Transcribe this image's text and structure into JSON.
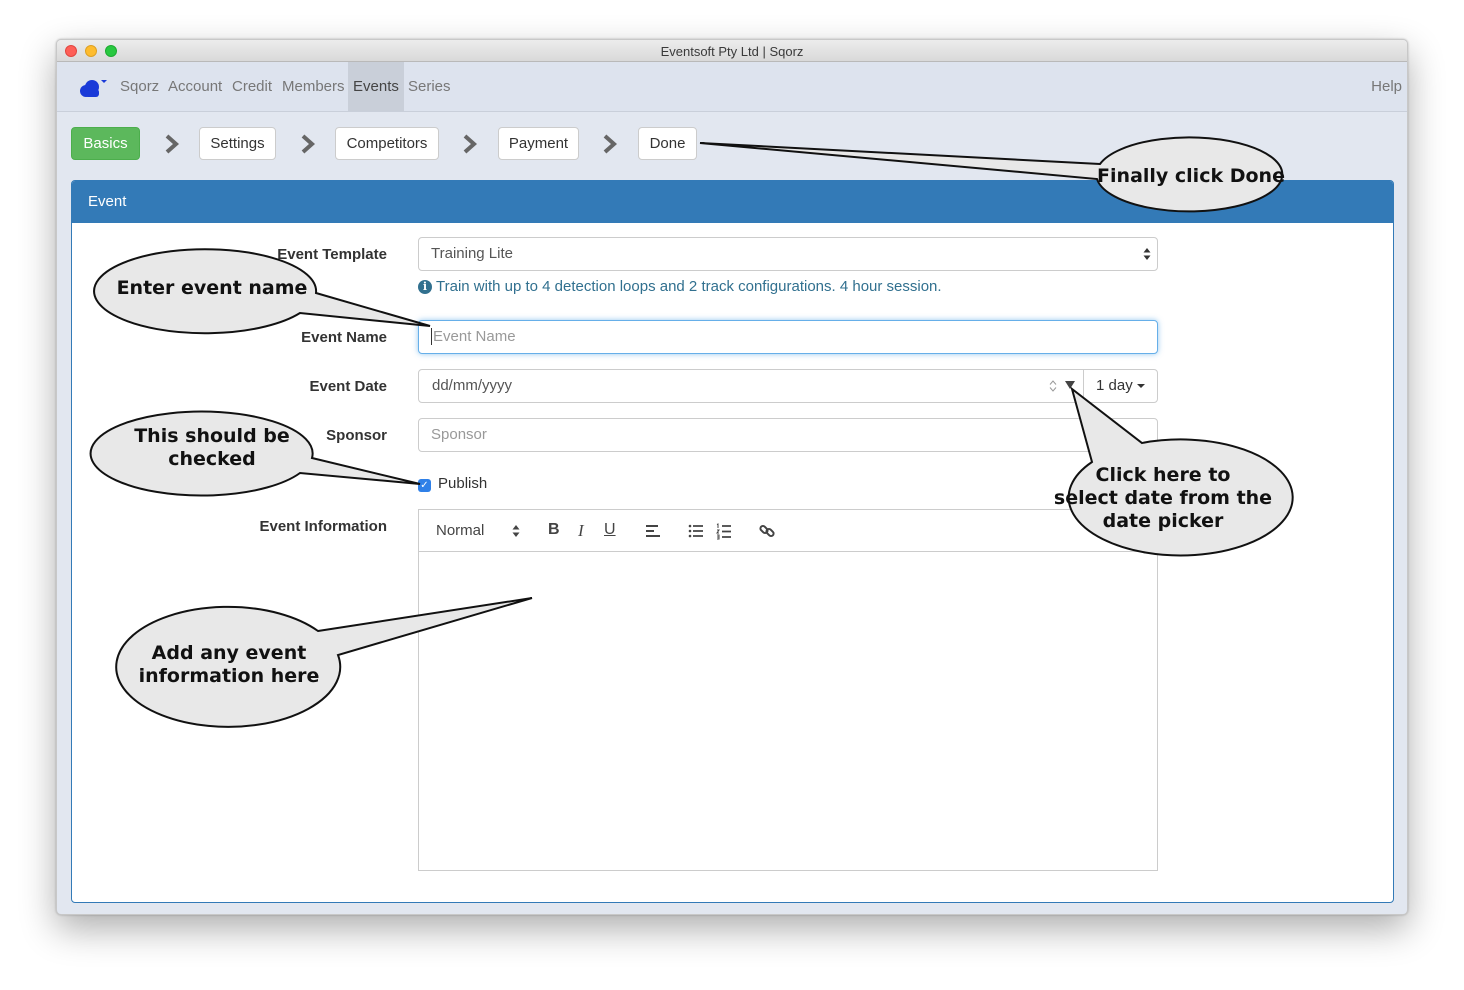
{
  "window": {
    "title": "Eventsoft Pty Ltd | Sqorz"
  },
  "navbar": {
    "brand_icon": "cloud-icon",
    "items": [
      {
        "label": "Sqorz"
      },
      {
        "label": "Account"
      },
      {
        "label": "Credit"
      },
      {
        "label": "Members"
      },
      {
        "label": "Events"
      },
      {
        "label": "Series"
      }
    ],
    "active": "Events",
    "help": "Help"
  },
  "wizard": {
    "steps": [
      {
        "label": "Basics"
      },
      {
        "label": "Settings"
      },
      {
        "label": "Competitors"
      },
      {
        "label": "Payment"
      },
      {
        "label": "Done"
      }
    ],
    "active": "Basics",
    "separator_icon": "chevron-right-icon"
  },
  "panel": {
    "title": "Event"
  },
  "form": {
    "template": {
      "label": "Event Template",
      "value": "Training Lite",
      "help": "Train with up to 4 detection loops and 2 track configurations. 4 hour session.",
      "help_icon": "info-icon"
    },
    "name": {
      "label": "Event Name",
      "placeholder": "Event Name",
      "value": ""
    },
    "date": {
      "label": "Event Date",
      "placeholder": "dd/mm/yyyy",
      "duration": "1 day"
    },
    "sponsor": {
      "label": "Sponsor",
      "placeholder": "Sponsor",
      "value": ""
    },
    "publish": {
      "label": "Publish",
      "checked": true
    },
    "info": {
      "label": "Event Information"
    }
  },
  "editor": {
    "format": "Normal",
    "bold": "B",
    "italic": "I",
    "underline": "U",
    "tools": [
      "align-left-icon",
      "bullet-list-icon",
      "numbered-list-icon",
      "link-icon"
    ]
  },
  "callouts": {
    "done": "Finally click Done",
    "name": "Enter event name",
    "publish_line1": "This should be",
    "publish_line2": "checked",
    "date_line1": "Click here to",
    "date_line2": "select date from the",
    "date_line3": "date picker",
    "info_line1": "Add any event",
    "info_line2": "information here"
  },
  "colors": {
    "primary": "#337ab7",
    "success": "#5cb85c",
    "help_text": "#31708f",
    "checkbox": "#2f80e8"
  }
}
